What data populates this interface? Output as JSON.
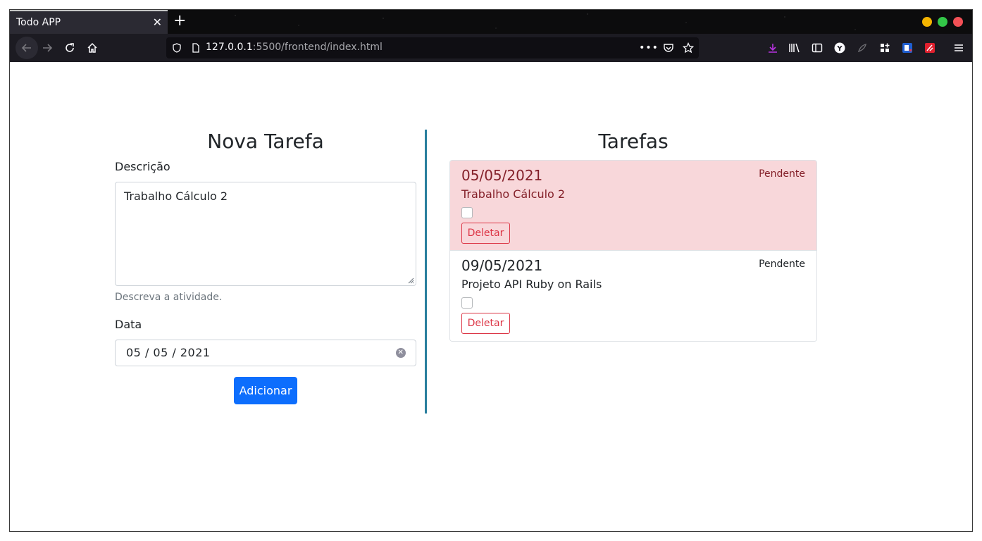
{
  "browser": {
    "tab_title": "Todo APP",
    "url_host": "127.0.0.1",
    "url_rest": ":5500/frontend/index.html",
    "traffic_colors": [
      "#f4b400",
      "#33c748",
      "#f25056"
    ]
  },
  "form": {
    "title": "Nova Tarefa",
    "description_label": "Descrição",
    "description_value": "Trabalho Cálculo 2",
    "description_help": "Descreva a atividade.",
    "date_label": "Data",
    "date_value": "05 / 05 / 2021",
    "submit_label": "Adicionar"
  },
  "tasks": {
    "title": "Tarefas",
    "items": [
      {
        "date": "05/05/2021",
        "description": "Trabalho Cálculo 2",
        "status": "Pendente",
        "delete_label": "Deletar",
        "style": "danger"
      },
      {
        "date": "09/05/2021",
        "description": "Projeto API Ruby on Rails",
        "status": "Pendente",
        "delete_label": "Deletar",
        "style": "plain"
      }
    ]
  },
  "colors": {
    "accent": "#0d6efd",
    "divider": "#2a7f9e",
    "danger_bg": "#f8d7da",
    "danger_text": "#842029"
  }
}
